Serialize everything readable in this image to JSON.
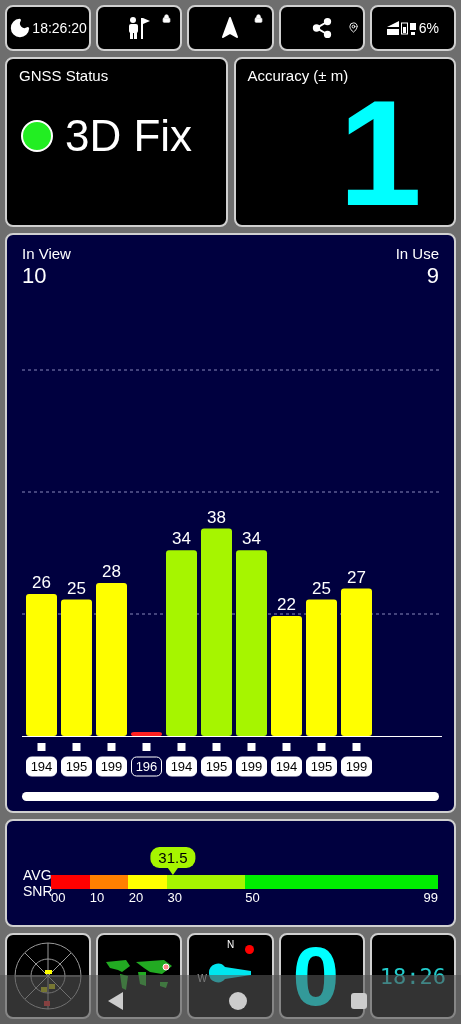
{
  "status_tiles": {
    "time": "18:26:20",
    "battery": "6%"
  },
  "gnss": {
    "title": "GNSS Status",
    "fix_label": "3D Fix",
    "fixed": true
  },
  "accuracy": {
    "title": "Accuracy (± m)",
    "value": "1"
  },
  "satellites": {
    "in_view_label": "In View",
    "in_view": "10",
    "in_use_label": "In Use",
    "in_use": "9",
    "chart_data": {
      "type": "bar",
      "categories": [
        "194",
        "195",
        "199",
        "196",
        "194",
        "195",
        "199",
        "194",
        "195",
        "199"
      ],
      "values": [
        26,
        25,
        28,
        0,
        34,
        38,
        34,
        22,
        25,
        27
      ],
      "value_labels": [
        "26",
        "25",
        "28",
        null,
        "34",
        "38",
        "34",
        "22",
        "25",
        "27"
      ]
    },
    "used": [
      {
        "in_use": true
      },
      {
        "in_use": true
      },
      {
        "in_use": true
      },
      {
        "in_use": false
      },
      {
        "in_use": true
      },
      {
        "in_use": true
      },
      {
        "in_use": true
      },
      {
        "in_use": true
      },
      {
        "in_use": true
      },
      {
        "in_use": true
      }
    ]
  },
  "snr": {
    "label_1": "AVG",
    "label_2": "SNR",
    "value": "31.5",
    "segments": [
      {
        "color": "#ff0000",
        "label": "00"
      },
      {
        "color": "#ff8000",
        "label": "10"
      },
      {
        "color": "#ffff00",
        "label": "20"
      },
      {
        "color": "#a6f500",
        "label": "30"
      },
      {
        "color": "#00ee00",
        "label": "50"
      }
    ],
    "end_label": "99"
  },
  "bottom_tiles": {
    "compass_north": "N",
    "compass_west": "W",
    "speed": "0",
    "clock": "18:26"
  }
}
